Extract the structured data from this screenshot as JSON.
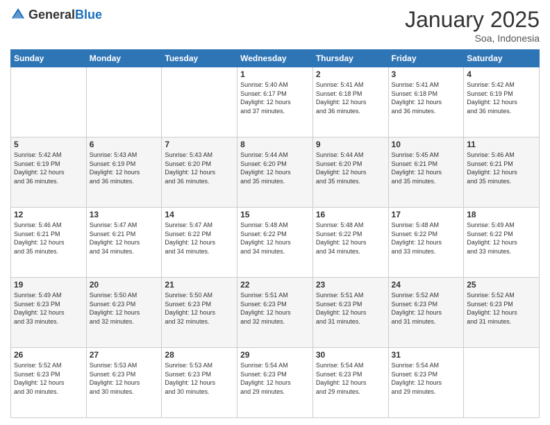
{
  "header": {
    "logo_general": "General",
    "logo_blue": "Blue",
    "month_year": "January 2025",
    "location": "Soa, Indonesia"
  },
  "weekdays": [
    "Sunday",
    "Monday",
    "Tuesday",
    "Wednesday",
    "Thursday",
    "Friday",
    "Saturday"
  ],
  "weeks": [
    [
      {
        "day": "",
        "info": ""
      },
      {
        "day": "",
        "info": ""
      },
      {
        "day": "",
        "info": ""
      },
      {
        "day": "1",
        "info": "Sunrise: 5:40 AM\nSunset: 6:17 PM\nDaylight: 12 hours\nand 37 minutes."
      },
      {
        "day": "2",
        "info": "Sunrise: 5:41 AM\nSunset: 6:18 PM\nDaylight: 12 hours\nand 36 minutes."
      },
      {
        "day": "3",
        "info": "Sunrise: 5:41 AM\nSunset: 6:18 PM\nDaylight: 12 hours\nand 36 minutes."
      },
      {
        "day": "4",
        "info": "Sunrise: 5:42 AM\nSunset: 6:19 PM\nDaylight: 12 hours\nand 36 minutes."
      }
    ],
    [
      {
        "day": "5",
        "info": "Sunrise: 5:42 AM\nSunset: 6:19 PM\nDaylight: 12 hours\nand 36 minutes."
      },
      {
        "day": "6",
        "info": "Sunrise: 5:43 AM\nSunset: 6:19 PM\nDaylight: 12 hours\nand 36 minutes."
      },
      {
        "day": "7",
        "info": "Sunrise: 5:43 AM\nSunset: 6:20 PM\nDaylight: 12 hours\nand 36 minutes."
      },
      {
        "day": "8",
        "info": "Sunrise: 5:44 AM\nSunset: 6:20 PM\nDaylight: 12 hours\nand 35 minutes."
      },
      {
        "day": "9",
        "info": "Sunrise: 5:44 AM\nSunset: 6:20 PM\nDaylight: 12 hours\nand 35 minutes."
      },
      {
        "day": "10",
        "info": "Sunrise: 5:45 AM\nSunset: 6:21 PM\nDaylight: 12 hours\nand 35 minutes."
      },
      {
        "day": "11",
        "info": "Sunrise: 5:46 AM\nSunset: 6:21 PM\nDaylight: 12 hours\nand 35 minutes."
      }
    ],
    [
      {
        "day": "12",
        "info": "Sunrise: 5:46 AM\nSunset: 6:21 PM\nDaylight: 12 hours\nand 35 minutes."
      },
      {
        "day": "13",
        "info": "Sunrise: 5:47 AM\nSunset: 6:21 PM\nDaylight: 12 hours\nand 34 minutes."
      },
      {
        "day": "14",
        "info": "Sunrise: 5:47 AM\nSunset: 6:22 PM\nDaylight: 12 hours\nand 34 minutes."
      },
      {
        "day": "15",
        "info": "Sunrise: 5:48 AM\nSunset: 6:22 PM\nDaylight: 12 hours\nand 34 minutes."
      },
      {
        "day": "16",
        "info": "Sunrise: 5:48 AM\nSunset: 6:22 PM\nDaylight: 12 hours\nand 34 minutes."
      },
      {
        "day": "17",
        "info": "Sunrise: 5:48 AM\nSunset: 6:22 PM\nDaylight: 12 hours\nand 33 minutes."
      },
      {
        "day": "18",
        "info": "Sunrise: 5:49 AM\nSunset: 6:22 PM\nDaylight: 12 hours\nand 33 minutes."
      }
    ],
    [
      {
        "day": "19",
        "info": "Sunrise: 5:49 AM\nSunset: 6:23 PM\nDaylight: 12 hours\nand 33 minutes."
      },
      {
        "day": "20",
        "info": "Sunrise: 5:50 AM\nSunset: 6:23 PM\nDaylight: 12 hours\nand 32 minutes."
      },
      {
        "day": "21",
        "info": "Sunrise: 5:50 AM\nSunset: 6:23 PM\nDaylight: 12 hours\nand 32 minutes."
      },
      {
        "day": "22",
        "info": "Sunrise: 5:51 AM\nSunset: 6:23 PM\nDaylight: 12 hours\nand 32 minutes."
      },
      {
        "day": "23",
        "info": "Sunrise: 5:51 AM\nSunset: 6:23 PM\nDaylight: 12 hours\nand 31 minutes."
      },
      {
        "day": "24",
        "info": "Sunrise: 5:52 AM\nSunset: 6:23 PM\nDaylight: 12 hours\nand 31 minutes."
      },
      {
        "day": "25",
        "info": "Sunrise: 5:52 AM\nSunset: 6:23 PM\nDaylight: 12 hours\nand 31 minutes."
      }
    ],
    [
      {
        "day": "26",
        "info": "Sunrise: 5:52 AM\nSunset: 6:23 PM\nDaylight: 12 hours\nand 30 minutes."
      },
      {
        "day": "27",
        "info": "Sunrise: 5:53 AM\nSunset: 6:23 PM\nDaylight: 12 hours\nand 30 minutes."
      },
      {
        "day": "28",
        "info": "Sunrise: 5:53 AM\nSunset: 6:23 PM\nDaylight: 12 hours\nand 30 minutes."
      },
      {
        "day": "29",
        "info": "Sunrise: 5:54 AM\nSunset: 6:23 PM\nDaylight: 12 hours\nand 29 minutes."
      },
      {
        "day": "30",
        "info": "Sunrise: 5:54 AM\nSunset: 6:23 PM\nDaylight: 12 hours\nand 29 minutes."
      },
      {
        "day": "31",
        "info": "Sunrise: 5:54 AM\nSunset: 6:23 PM\nDaylight: 12 hours\nand 29 minutes."
      },
      {
        "day": "",
        "info": ""
      }
    ]
  ]
}
